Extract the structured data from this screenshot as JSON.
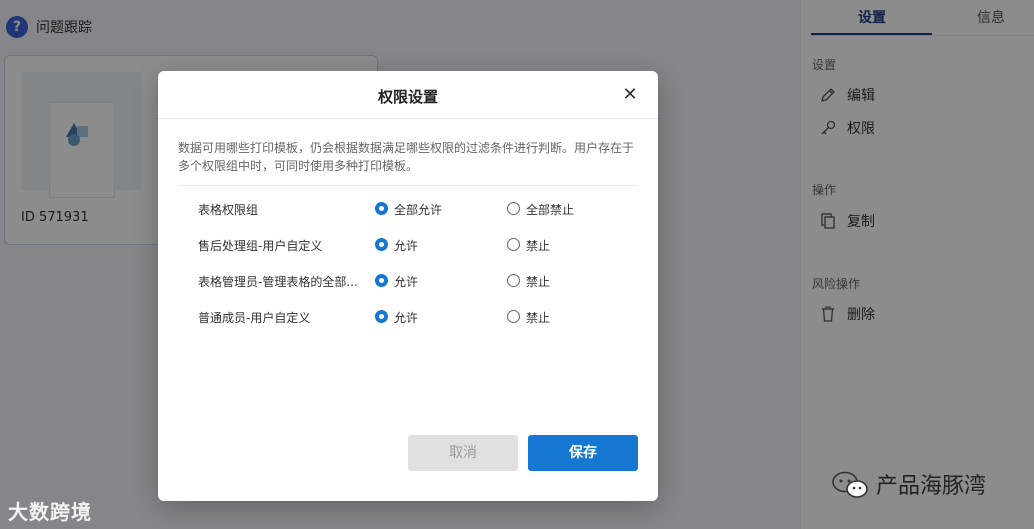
{
  "app": {
    "logo_glyph": "?",
    "title": "问题跟踪"
  },
  "card": {
    "id_label": "ID 571931"
  },
  "right_panel": {
    "tabs": [
      {
        "label": "设置",
        "active": true
      },
      {
        "label": "信息",
        "active": false
      }
    ],
    "sections": {
      "settings_title": "设置",
      "edit_label": "编辑",
      "permission_label": "权限",
      "operations_title": "操作",
      "copy_label": "复制",
      "risk_title": "风险操作",
      "delete_label": "删除"
    }
  },
  "modal": {
    "title": "权限设置",
    "close_glyph": "✕",
    "description": "数据可用哪些打印模板，仍会根据数据满足哪些权限的过滤条件进行判断。用户存在于多个权限组中时，可同时使用多种打印模板。",
    "rows": [
      {
        "name": "表格权限组",
        "allow_label": "全部允许",
        "deny_label": "全部禁止",
        "selected": "allow"
      },
      {
        "name": "售后处理组-用户自定义",
        "allow_label": "允许",
        "deny_label": "禁止",
        "selected": "allow"
      },
      {
        "name": "表格管理员-管理表格的全部...",
        "allow_label": "允许",
        "deny_label": "禁止",
        "selected": "allow"
      },
      {
        "name": "普通成员-用户自定义",
        "allow_label": "允许",
        "deny_label": "禁止",
        "selected": "allow"
      }
    ],
    "cancel_label": "取消",
    "save_label": "保存"
  },
  "watermarks": {
    "left": "大数跨境",
    "right": "产品海豚湾"
  },
  "colors": {
    "primary": "#1677d2",
    "tab_active": "#1f3e86",
    "logo": "#3b62d9",
    "overlay": "rgba(0,0,0,0.45)"
  }
}
